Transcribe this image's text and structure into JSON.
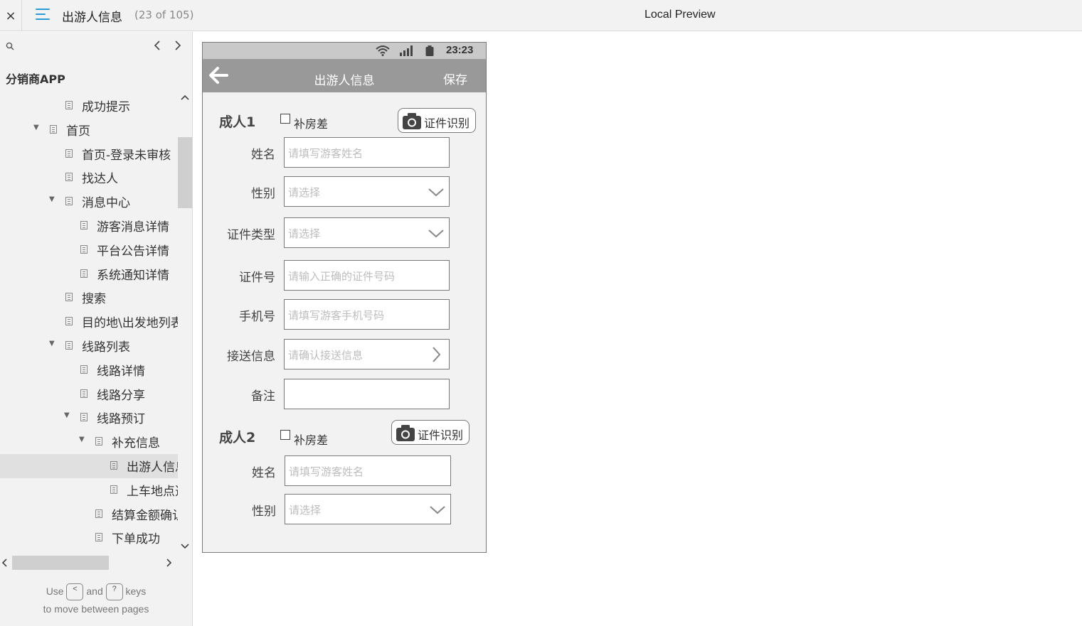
{
  "header": {
    "close_glyph": "×",
    "page_title": "出游人信息",
    "page_count": "(23 of 105)",
    "preview_label": "Local Preview"
  },
  "sidebar": {
    "project_title": "分销商APP",
    "items": [
      {
        "label": "成功提示",
        "level": 2,
        "arrow": false
      },
      {
        "label": "首页",
        "level": 1,
        "arrow": true
      },
      {
        "label": "首页-登录未审核",
        "level": 2,
        "arrow": false
      },
      {
        "label": "找达人",
        "level": 2,
        "arrow": false
      },
      {
        "label": "消息中心",
        "level": 2,
        "arrow": true
      },
      {
        "label": "游客消息详情",
        "level": 3,
        "arrow": false
      },
      {
        "label": "平台公告详情",
        "level": 3,
        "arrow": false
      },
      {
        "label": "系统通知详情",
        "level": 3,
        "arrow": false
      },
      {
        "label": "搜索",
        "level": 2,
        "arrow": false
      },
      {
        "label": "目的地\\出发地列表",
        "level": 2,
        "arrow": false
      },
      {
        "label": "线路列表",
        "level": 2,
        "arrow": true
      },
      {
        "label": "线路详情",
        "level": 3,
        "arrow": false
      },
      {
        "label": "线路分享",
        "level": 3,
        "arrow": false
      },
      {
        "label": "线路预订",
        "level": 3,
        "arrow": true
      },
      {
        "label": "补充信息",
        "level": 4,
        "arrow": true
      },
      {
        "label": "出游人信息",
        "level": 5,
        "arrow": false,
        "selected": true
      },
      {
        "label": "上车地点选择",
        "level": 5,
        "arrow": false
      },
      {
        "label": "结算金额确认",
        "level": 4,
        "arrow": false
      },
      {
        "label": "下单成功",
        "level": 4,
        "arrow": false
      }
    ],
    "hint_use": "Use",
    "hint_and": "and",
    "hint_keys": "keys",
    "hint_line2": "to move between pages",
    "key_prev": "<",
    "key_next": "?"
  },
  "phone": {
    "time": "23:23",
    "nav_title": "出游人信息",
    "save_label": "保存",
    "adult1": {
      "title": "成人1",
      "checkbox_label": "补房差",
      "ocr_label": "证件识别",
      "fields": [
        {
          "label": "姓名",
          "placeholder": "请填写游客姓名"
        },
        {
          "label": "性别",
          "placeholder": "请选择"
        },
        {
          "label": "证件类型",
          "placeholder": "请选择"
        },
        {
          "label": "证件号",
          "placeholder": "请输入正确的证件号码"
        },
        {
          "label": "手机号",
          "placeholder": "请填写游客手机号码"
        },
        {
          "label": "接送信息",
          "placeholder": "请确认接送信息"
        },
        {
          "label": "备注",
          "placeholder": ""
        }
      ]
    },
    "adult2": {
      "title": "成人2",
      "checkbox_label": "补房差",
      "ocr_label": "证件识别",
      "fields": [
        {
          "label": "姓名",
          "placeholder": "请填写游客姓名"
        },
        {
          "label": "性别",
          "placeholder": "请选择"
        }
      ]
    }
  }
}
